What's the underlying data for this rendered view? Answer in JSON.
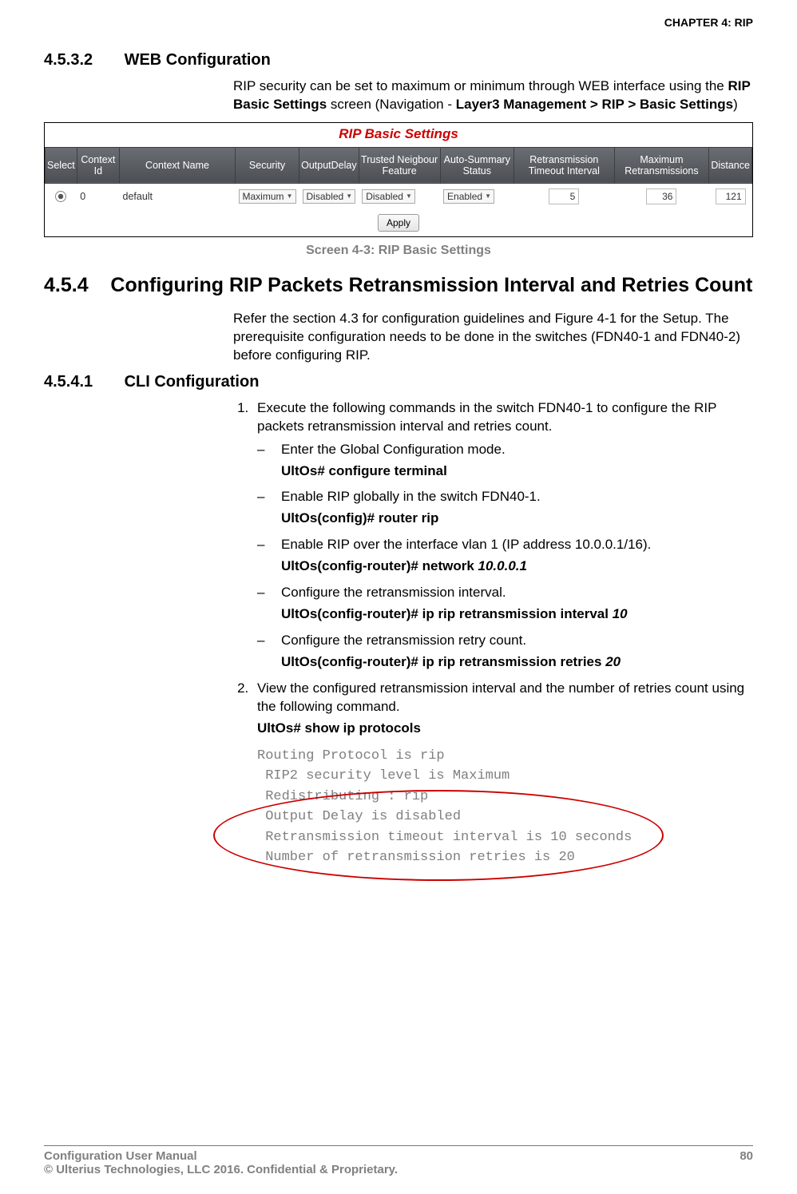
{
  "chapterHeader": "CHAPTER 4: RIP",
  "s4532": {
    "num": "4.5.3.2",
    "title": "WEB Configuration",
    "paraPrefix": "RIP security can be set to maximum or minimum through WEB interface using the ",
    "screenName": "RIP Basic Settings",
    "navIntro": " screen (Navigation - ",
    "navBold": "Layer3 Management > RIP > Basic Settings",
    "navEnd": ")"
  },
  "screenshot": {
    "title": "RIP Basic Settings",
    "headers": [
      "Select",
      "Context Id",
      "Context Name",
      "Security",
      "OutputDelay",
      "Trusted Neigbour Feature",
      "Auto-Summary Status",
      "Retransmission Timeout Interval",
      "Maximum Retransmissions",
      "Distance"
    ],
    "row": {
      "contextId": "0",
      "contextName": "default",
      "security": "Maximum",
      "outputDelay": "Disabled",
      "trusted": "Disabled",
      "autoSummary": "Enabled",
      "retransInterval": "5",
      "maxRetrans": "36",
      "distance": "121"
    },
    "applyLabel": "Apply"
  },
  "figCaption": "Screen 4-3: RIP Basic Settings",
  "s454": {
    "num": "4.5.4",
    "title": "Configuring RIP Packets Retransmission Interval and Retries Count",
    "para": "Refer the section 4.3 for configuration guidelines and Figure 4-1 for the Setup. The prerequisite configuration needs to be done in the switches (FDN40-1 and FDN40-2) before configuring RIP."
  },
  "s4541": {
    "num": "4.5.4.1",
    "title": "CLI Configuration",
    "step1": "Execute the following commands in the switch FDN40-1 to configure the RIP packets retransmission interval and retries count.",
    "d1": "Enter the Global Configuration mode.",
    "c1": "UltOs# configure terminal",
    "d2": "Enable RIP globally in the switch FDN40-1.",
    "c2": "UltOs(config)# router rip",
    "d3": "Enable RIP over the interface vlan 1 (IP address 10.0.0.1/16).",
    "c3a": "UltOs(config-router)# network ",
    "c3b": "10.0.0.1",
    "d4": "Configure the retransmission interval.",
    "c4a": "UltOs(config-router)# ip rip retransmission interval ",
    "c4b": "10",
    "d5": "Configure the retransmission retry count.",
    "c5a": "UltOs(config-router)# ip rip retransmission retries ",
    "c5b": "20",
    "step2": "View the configured retransmission interval and the number of retries count using the following command.",
    "c6": "UltOs# show ip protocols",
    "out": {
      "l1": "Routing Protocol is rip",
      "l2": " RIP2 security level is Maximum",
      "l3": " Redistributing : rip",
      "l4": " Output Delay is disabled",
      "l5": " Retransmission timeout interval is 10 seconds",
      "l6": " Number of retransmission retries is 20"
    }
  },
  "footer": {
    "left1": "Configuration User Manual",
    "left2": "© Ulterius Technologies, LLC 2016. Confidential & Proprietary.",
    "pageNum": "80"
  }
}
